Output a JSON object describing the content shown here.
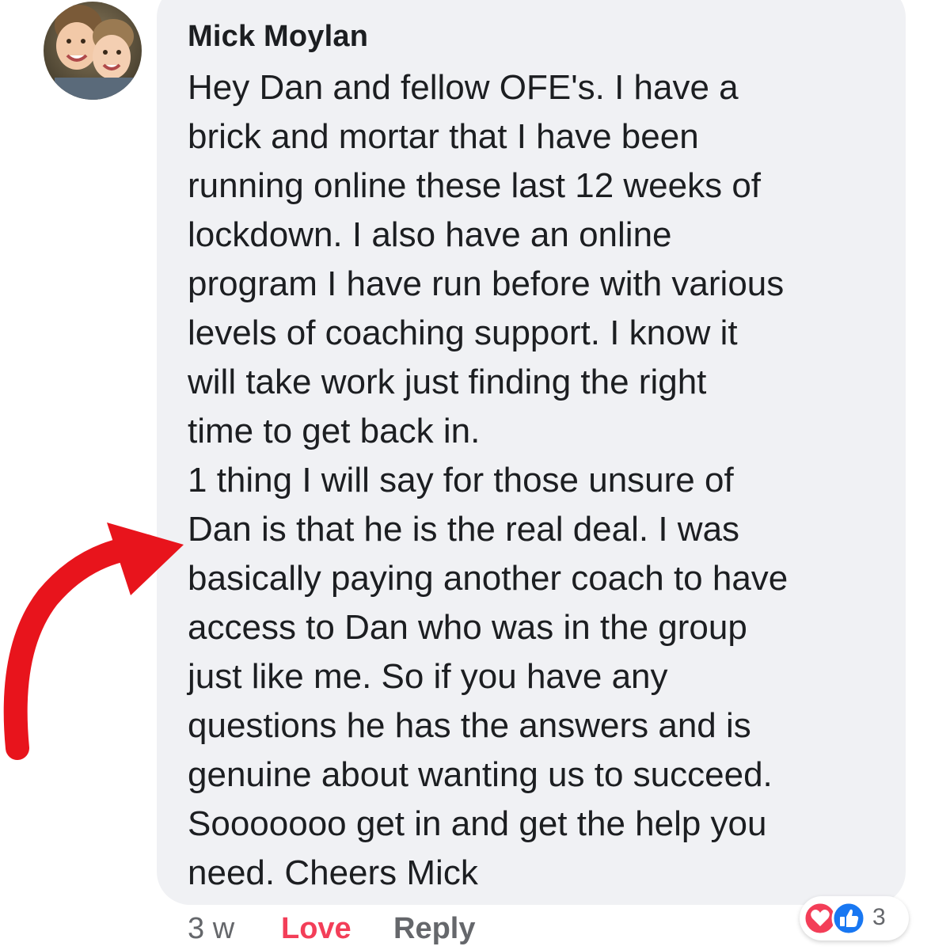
{
  "comment": {
    "author": "Mick Moylan",
    "lines": [
      "Hey Dan and fellow OFE's. I have a",
      "brick and mortar that I have been",
      "running online these last 12 weeks of",
      "lockdown. I also have an online",
      "program I have run before with various",
      "levels of coaching support. I know it",
      "will take work just finding the right",
      "time to get back in.",
      "1 thing I will say for those unsure of",
      "Dan is that he is the real deal. I was",
      "basically paying another coach to have",
      "access to Dan who was in the group",
      "just like me. So if you have any",
      "questions he has the answers and is",
      "genuine about wanting us to succeed.",
      "Sooooooo get in and get the help you",
      "need. Cheers Mick"
    ]
  },
  "actions": {
    "time": "3 w",
    "love_label": "Love",
    "reply_label": "Reply"
  },
  "reactions": {
    "types": [
      "heart-icon",
      "like-icon"
    ],
    "count": "3"
  },
  "colors": {
    "bubble": "#f0f1f4",
    "love": "#f33e58",
    "like": "#1877f2",
    "arrow": "#e8141c",
    "text": "#1c1e21",
    "meta": "#65676b"
  }
}
